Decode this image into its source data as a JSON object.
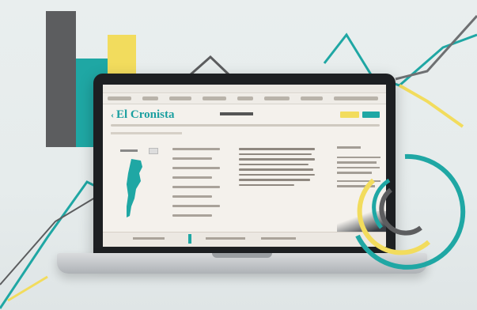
{
  "site": {
    "brand": "El Cronista",
    "back_arrow": "‹"
  },
  "colors": {
    "accent_teal": "#1fa7a4",
    "accent_yellow": "#f2dc5d",
    "dark_gray": "#5c5d5f",
    "background": "#e8eded"
  },
  "icons": {
    "back": "chevron-left-icon",
    "map": "argentina-map-icon"
  }
}
